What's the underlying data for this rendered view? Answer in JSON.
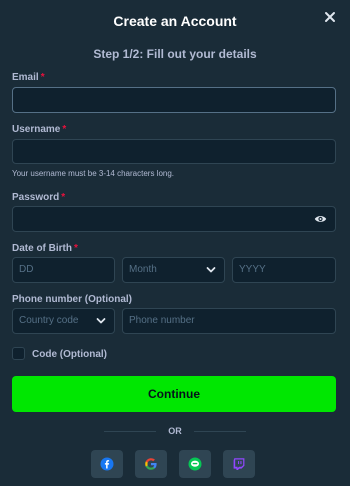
{
  "header": {
    "title": "Create an Account",
    "step": "Step 1/2: Fill out your details"
  },
  "form": {
    "email": {
      "label": "Email",
      "required_mark": "*",
      "value": ""
    },
    "username": {
      "label": "Username",
      "required_mark": "*",
      "value": "",
      "hint": "Your username must be 3-14 characters long."
    },
    "password": {
      "label": "Password",
      "required_mark": "*",
      "value": ""
    },
    "dob": {
      "label": "Date of Birth",
      "required_mark": "*",
      "day_placeholder": "DD",
      "month_placeholder": "Month",
      "year_placeholder": "YYYY"
    },
    "phone": {
      "label": "Phone number (Optional)",
      "country_placeholder": "Country code",
      "number_placeholder": "Phone number"
    },
    "code": {
      "label": "Code (Optional)",
      "checked": false
    }
  },
  "actions": {
    "continue_label": "Continue",
    "or_label": "OR"
  },
  "social": [
    {
      "icon": "facebook-icon",
      "color": "#1877f2"
    },
    {
      "icon": "google-icon",
      "color": "#ea4335"
    },
    {
      "icon": "line-icon",
      "color": "#06c755"
    },
    {
      "icon": "twitch-icon",
      "color": "#9146ff"
    }
  ],
  "colors": {
    "accent": "#00e701",
    "required": "#e9113c",
    "panel": "#1a2c38",
    "input_bg": "#0f212e"
  }
}
